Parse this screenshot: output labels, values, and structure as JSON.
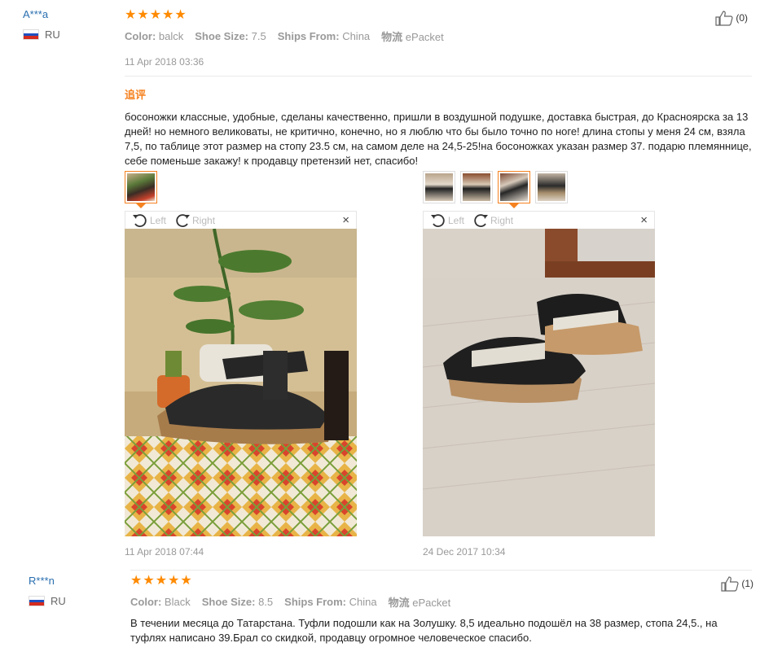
{
  "reviews": [
    {
      "username": "A***a",
      "country": "RU",
      "stars": 5,
      "attrs": {
        "color_label": "Color:",
        "color_value": "balck",
        "size_label": "Shoe Size:",
        "size_value": "7.5",
        "ships_label": "Ships From:",
        "ships_value": "China",
        "logistics_label": "物流",
        "logistics_value": "ePacket"
      },
      "date": "11 Apr 2018 03:36",
      "helpful_count": "(0)",
      "append_title": "追评",
      "text": "босоножки классные, удобные, сделаны качественно, пришли в воздушной подушке, доставка быстрая, до Красноярска за 13 дней! но немного великоваты, не критично, конечно, но я люблю что бы было точно по ноге! длина стопы у меня 24 см, взяла 7,5, по таблице этот размер на стопу 23.5 см, на самом деле на 24,5-25!на босоножках указан размер 37. подарю племяннице, себе поменьше закажу! к продавцу претензий нет, спасибо!",
      "viewer_left_label": "Left",
      "viewer_right_label": "Right",
      "close_glyph": "×",
      "photo_dates": [
        "11 Apr 2018 07:44",
        "24 Dec 2017 10:34"
      ]
    },
    {
      "username": "R***n",
      "country": "RU",
      "stars": 5,
      "attrs": {
        "color_label": "Color:",
        "color_value": "Black",
        "size_label": "Shoe Size:",
        "size_value": "8.5",
        "ships_label": "Ships From:",
        "ships_value": "China",
        "logistics_label": "物流",
        "logistics_value": "ePacket"
      },
      "helpful_count": "(1)",
      "text": "В течении месяца до Татарстана. Туфли подошли как на Золушку. 8,5 идеально подошёл на 38 размер, стопа 24,5., на туфлях написано 39.Брал со скидкой, продавцу огромное человеческое спасибо."
    }
  ],
  "colors": {
    "star": "#ff8a00",
    "accent": "#f58220",
    "link": "#2a6fb0"
  },
  "icons": {
    "star": "★",
    "thumb_up": "thumb-up-icon",
    "rotate_left": "rotate-left-icon",
    "rotate_right": "rotate-right-icon"
  }
}
